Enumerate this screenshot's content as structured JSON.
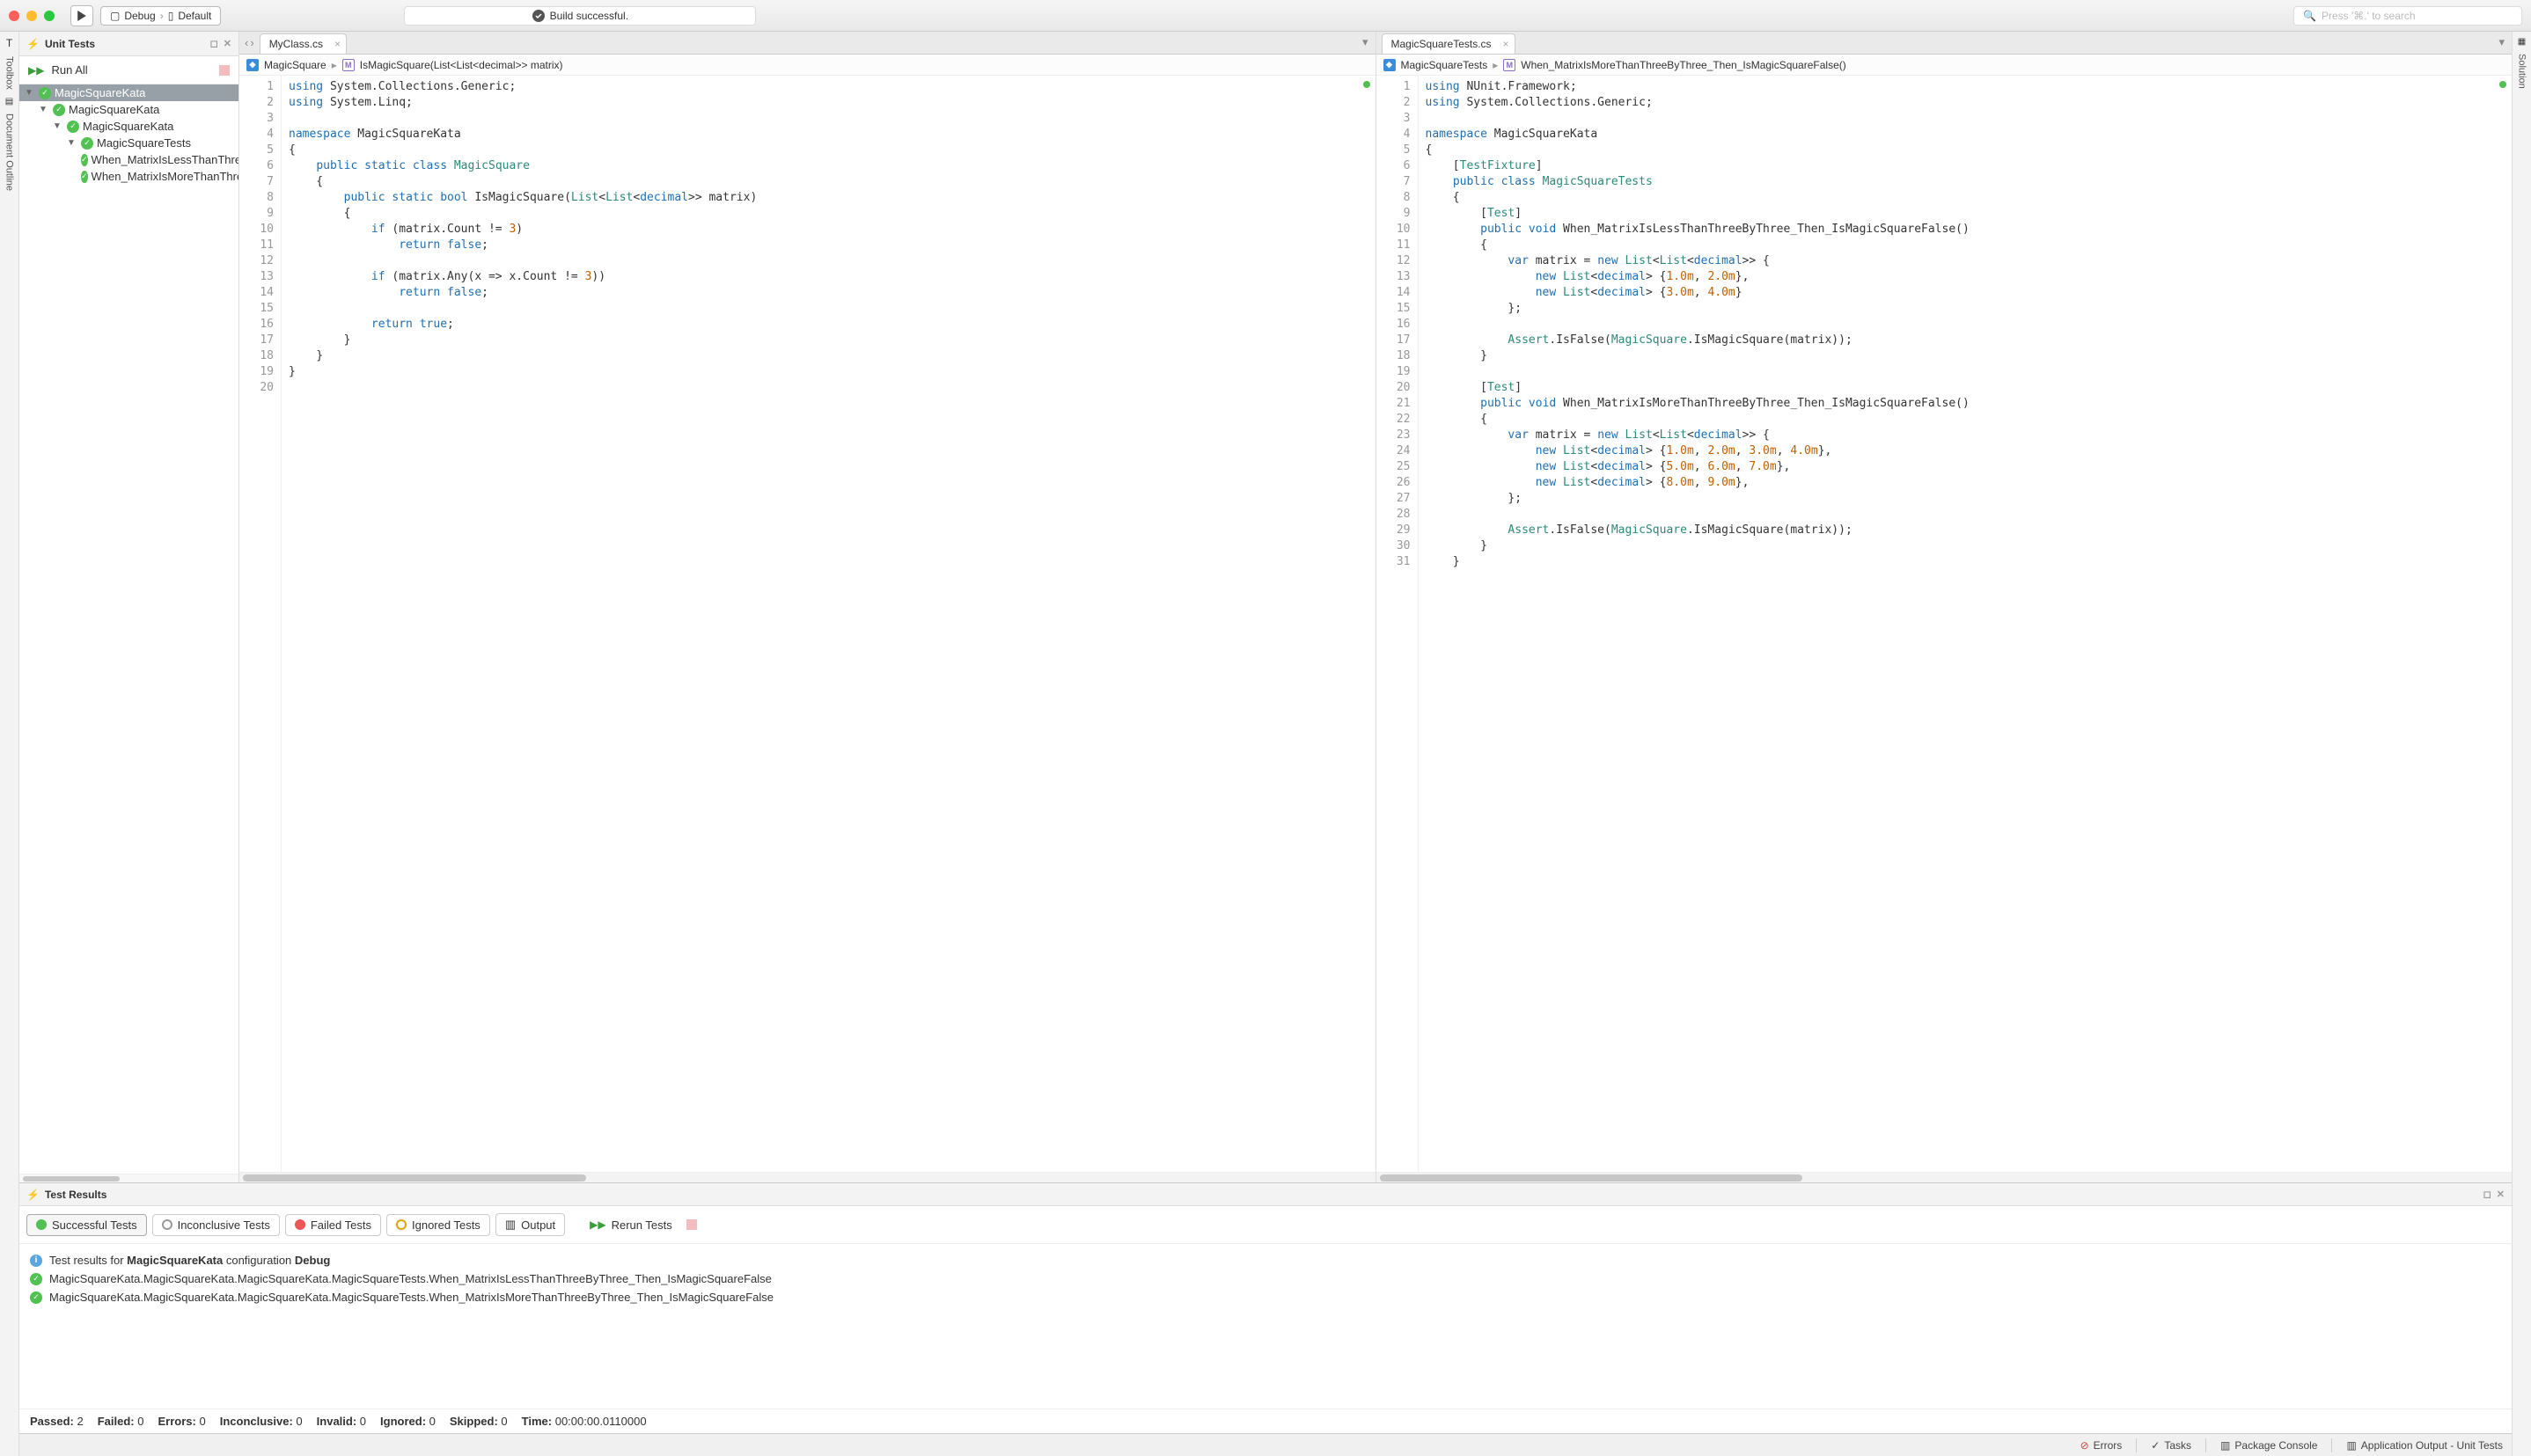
{
  "titlebar": {
    "config_label": "Debug",
    "config_target": "Default",
    "status": "Build successful.",
    "search_placeholder": "Press '⌘.' to search"
  },
  "left_rail": {
    "toolbox": "Toolbox",
    "outline": "Document Outline"
  },
  "right_rail": {
    "solution": "Solution"
  },
  "tests_panel": {
    "title": "Unit Tests",
    "run_all": "Run All",
    "tree": {
      "root": "MagicSquareKata",
      "n1": "MagicSquareKata",
      "n2": "MagicSquareKata",
      "n3": "MagicSquareTests",
      "leaf1": "When_MatrixIsLessThanThreeByThree_Then_IsMagicSquareFalse",
      "leaf2": "When_MatrixIsMoreThanThreeByThree_Then_IsMagicSquareFalse"
    }
  },
  "editor_left": {
    "tab": "MyClass.cs",
    "crumb_ns": "MagicSquare",
    "crumb_method": "IsMagicSquare(List<List<decimal>> matrix)",
    "lines": 20
  },
  "editor_right": {
    "tab": "MagicSquareTests.cs",
    "crumb_ns": "MagicSquareTests",
    "crumb_method": "When_MatrixIsMoreThanThreeByThree_Then_IsMagicSquareFalse()",
    "lines": 31
  },
  "results": {
    "title": "Test Results",
    "filters": {
      "successful": "Successful Tests",
      "inconclusive": "Inconclusive Tests",
      "failed": "Failed Tests",
      "ignored": "Ignored Tests",
      "output": "Output",
      "rerun": "Rerun Tests"
    },
    "summary_prefix": "Test results for ",
    "summary_project": "MagicSquareKata",
    "summary_mid": " configuration ",
    "summary_config": "Debug",
    "row1": "MagicSquareKata.MagicSquareKata.MagicSquareKata.MagicSquareTests.When_MatrixIsLessThanThreeByThree_Then_IsMagicSquareFalse",
    "row2": "MagicSquareKata.MagicSquareKata.MagicSquareKata.MagicSquareTests.When_MatrixIsMoreThanThreeByThree_Then_IsMagicSquareFalse",
    "stats": {
      "passed_l": "Passed:",
      "passed_v": "2",
      "failed_l": "Failed:",
      "failed_v": "0",
      "errors_l": "Errors:",
      "errors_v": "0",
      "inconclusive_l": "Inconclusive:",
      "inconclusive_v": "0",
      "invalid_l": "Invalid:",
      "invalid_v": "0",
      "ignored_l": "Ignored:",
      "ignored_v": "0",
      "skipped_l": "Skipped:",
      "skipped_v": "0",
      "time_l": "Time:",
      "time_v": "00:00:00.0110000"
    }
  },
  "statusbar": {
    "errors": "Errors",
    "tasks": "Tasks",
    "pkg": "Package Console",
    "appout": "Application Output - Unit Tests"
  }
}
